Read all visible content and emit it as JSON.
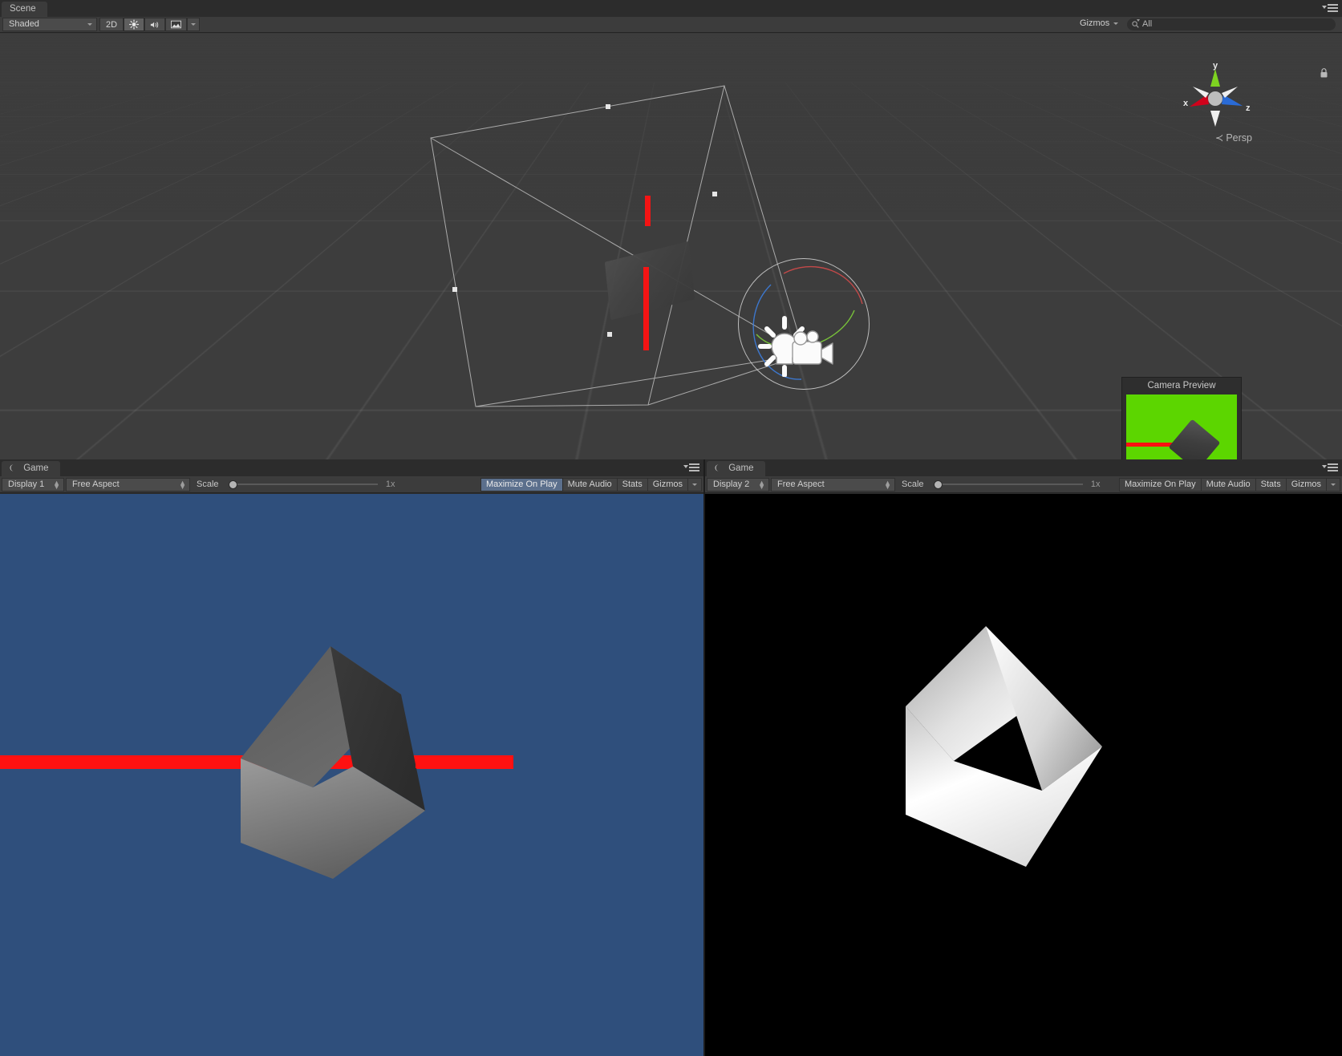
{
  "scene_view": {
    "tab_label": "Scene",
    "toolbar": {
      "draw_mode": "Shaded",
      "mode_2d": "2D",
      "lighting_icon": "sun-icon",
      "audio_icon": "audio-speaker-icon",
      "effects_icon": "image-effects-icon",
      "gizmos_label": "Gizmos",
      "search_placeholder": "All",
      "search_value": "All",
      "search_icon": "search-icon"
    },
    "overlay": {
      "projection_label": "Persp",
      "axis_x_label": "x",
      "axis_y_label": "y",
      "axis_z_label": "z",
      "lock_icon": "lock-icon"
    },
    "camera_preview": {
      "title": "Camera Preview",
      "background_color": "#5cd600",
      "line_color": "#ff1010"
    },
    "gizmos": {
      "light_icon": "light-bulb-icon",
      "camera_icon": "camera-icon",
      "selection_outline_color": "#ffffff",
      "move_axis_color": "#f41414"
    }
  },
  "game_views": [
    {
      "tab_label": "Game",
      "display": "Display 1",
      "aspect": "Free Aspect",
      "scale_label": "Scale",
      "scale_value": "1x",
      "maximize_on_play": "Maximize On Play",
      "maximize_on_play_active": true,
      "mute_audio": "Mute Audio",
      "stats": "Stats",
      "gizmos": "Gizmos",
      "background_color": "#2f4f7c",
      "line_color": "#ff1111"
    },
    {
      "tab_label": "Game",
      "display": "Display 2",
      "aspect": "Free Aspect",
      "scale_label": "Scale",
      "scale_value": "1x",
      "maximize_on_play": "Maximize On Play",
      "maximize_on_play_active": false,
      "mute_audio": "Mute Audio",
      "stats": "Stats",
      "gizmos": "Gizmos",
      "background_color": "#000000",
      "line_color": "#ff1111"
    }
  ]
}
